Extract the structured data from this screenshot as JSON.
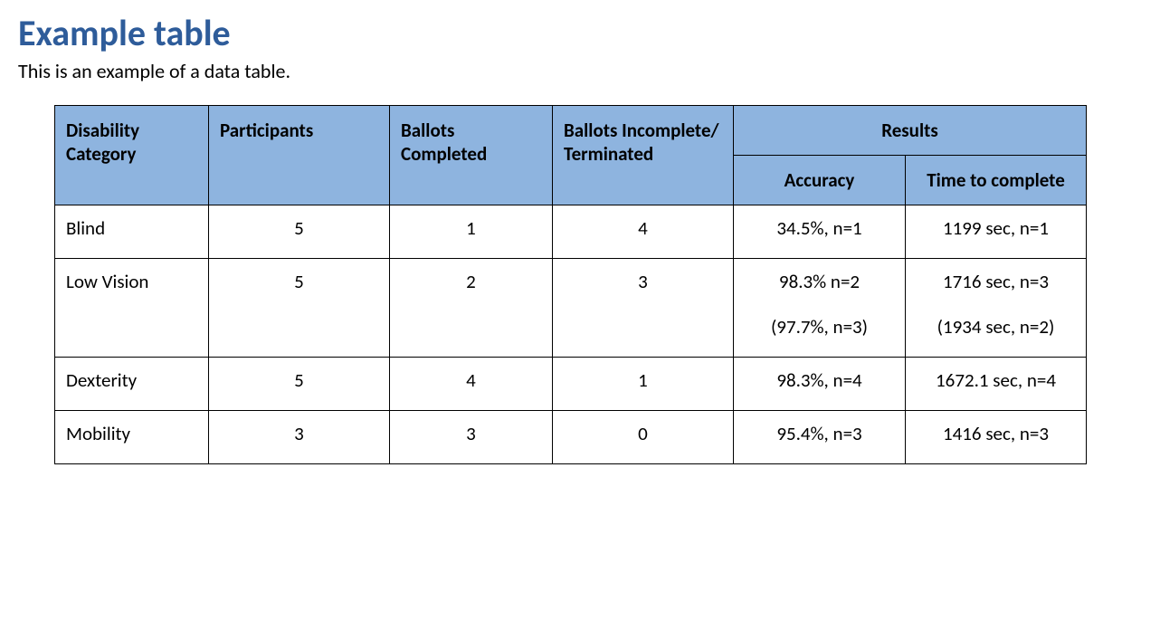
{
  "title": "Example table",
  "subtitle": "This is an example of a data table.",
  "headers": {
    "disability_category": "Disability Category",
    "participants": "Participants",
    "ballots_completed": "Ballots Completed",
    "ballots_incomplete": "Ballots Incomplete/ Terminated",
    "results_group": "Results",
    "accuracy": "Accuracy",
    "time_to_complete": "Time to complete"
  },
  "rows": [
    {
      "category": "Blind",
      "participants": "5",
      "completed": "1",
      "incomplete": "4",
      "accuracy": "34.5%, n=1",
      "accuracy2": "",
      "time": "1199 sec, n=1",
      "time2": ""
    },
    {
      "category": "Low Vision",
      "participants": "5",
      "completed": "2",
      "incomplete": "3",
      "accuracy": "98.3% n=2",
      "accuracy2": "(97.7%, n=3)",
      "time": "1716 sec, n=3",
      "time2": "(1934 sec, n=2)"
    },
    {
      "category": "Dexterity",
      "participants": "5",
      "completed": "4",
      "incomplete": "1",
      "accuracy": "98.3%, n=4",
      "accuracy2": "",
      "time": "1672.1 sec, n=4",
      "time2": ""
    },
    {
      "category": "Mobility",
      "participants": "3",
      "completed": "3",
      "incomplete": "0",
      "accuracy": "95.4%, n=3",
      "accuracy2": "",
      "time": "1416 sec, n=3",
      "time2": ""
    }
  ],
  "chart_data": {
    "type": "table",
    "title": "Example table",
    "columns": [
      "Disability Category",
      "Participants",
      "Ballots Completed",
      "Ballots Incomplete/Terminated",
      "Accuracy",
      "Time to complete"
    ],
    "rows": [
      [
        "Blind",
        5,
        1,
        4,
        "34.5%, n=1",
        "1199 sec, n=1"
      ],
      [
        "Low Vision",
        5,
        2,
        3,
        "98.3% n=2 (97.7%, n=3)",
        "1716 sec, n=3 (1934 sec, n=2)"
      ],
      [
        "Dexterity",
        5,
        4,
        1,
        "98.3%, n=4",
        "1672.1 sec, n=4"
      ],
      [
        "Mobility",
        3,
        3,
        0,
        "95.4%, n=3",
        "1416 sec, n=3"
      ]
    ]
  }
}
